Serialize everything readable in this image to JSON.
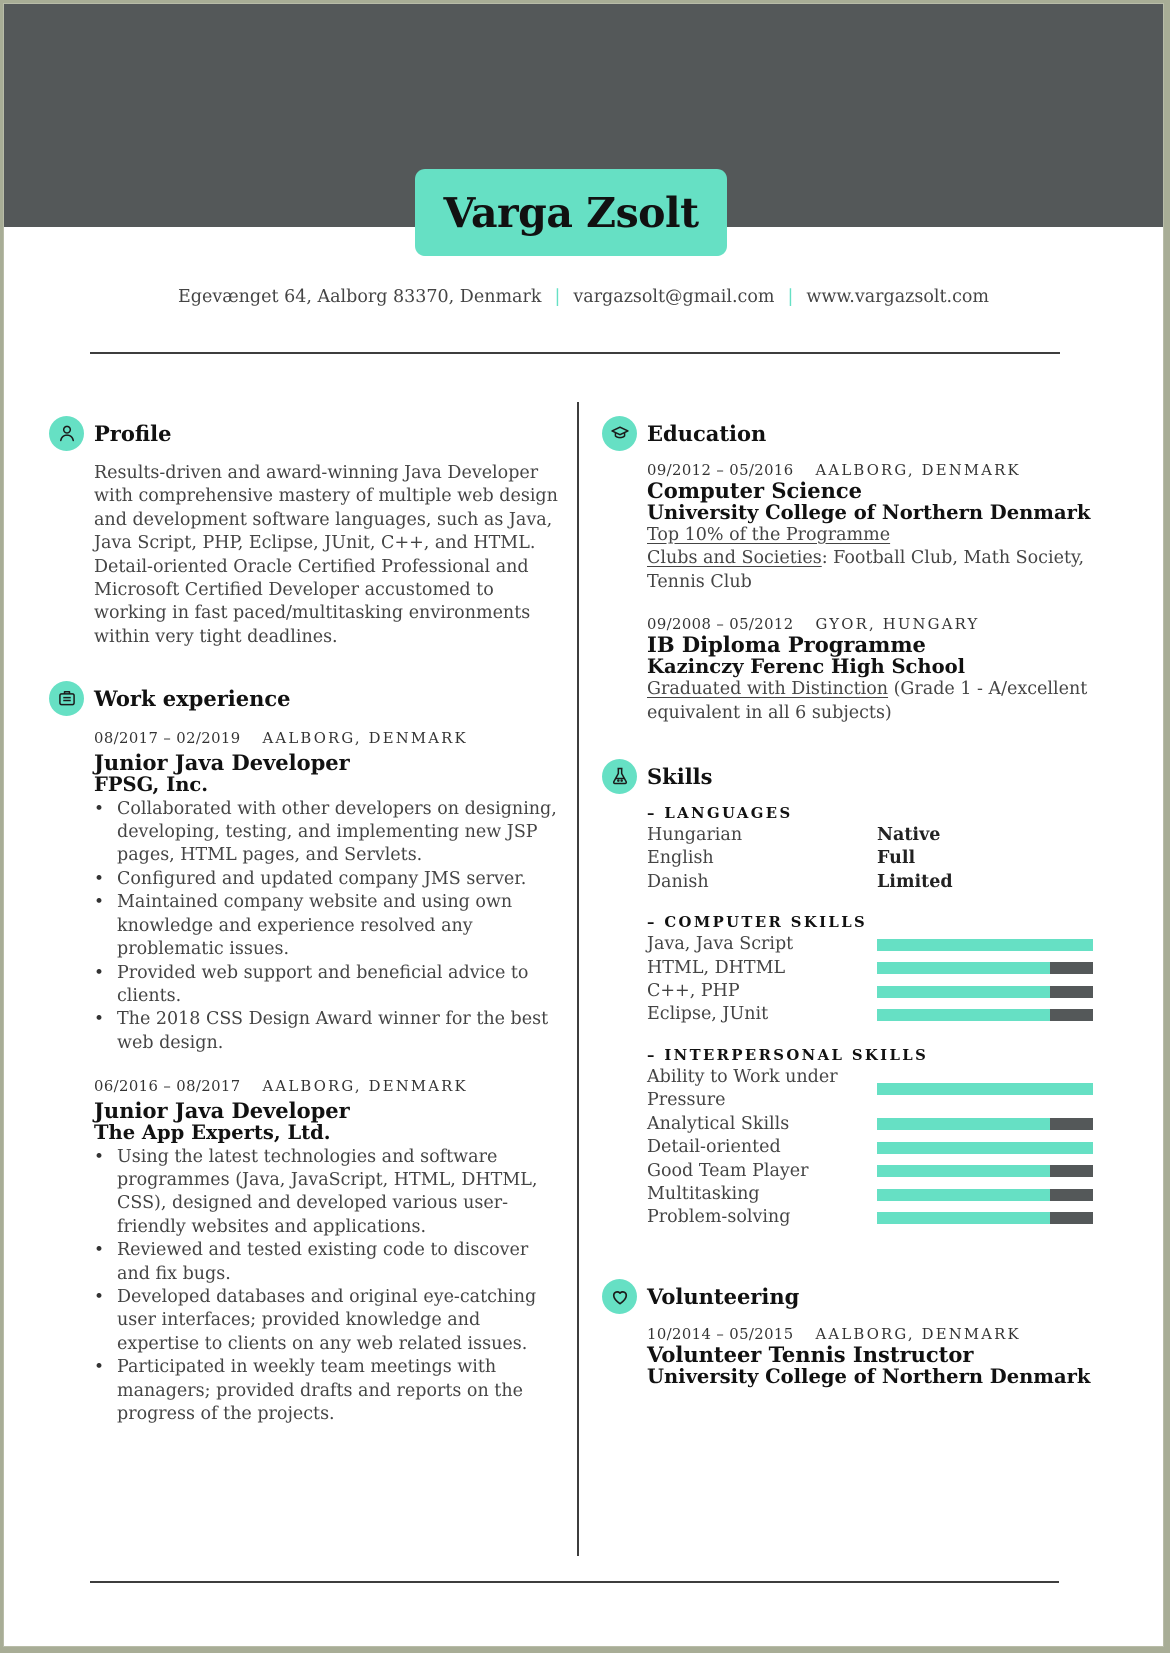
{
  "header": {
    "name": "Varga Zsolt",
    "address": "Egevænget 64, Aalborg 83370, Denmark",
    "email": "vargazsolt@gmail.com",
    "website": "www.vargazsolt.com",
    "separator": "|"
  },
  "colors": {
    "accent": "#66e0c4",
    "header_band": "#545859",
    "text_dark": "#111111",
    "text_body": "#444444"
  },
  "profile": {
    "title": "Profile",
    "icon": "person-icon",
    "paragraphs": [
      "Results-driven and award-winning Java Developer with comprehensive mastery of multiple web design and development software languages, such as Java, Java Script, PHP, Eclipse, JUnit, C++, and HTML.",
      "Detail-oriented Oracle Certified Professional and Microsoft Certified Developer accustomed to working in fast paced/multitasking environments within very tight deadlines."
    ]
  },
  "work": {
    "title": "Work experience",
    "icon": "briefcase-icon",
    "jobs": [
      {
        "dates": "08/2017 – 02/2019",
        "location": "AALBORG, DENMARK",
        "role": "Junior Java Developer",
        "company": "FPSG, Inc.",
        "bullets": [
          "Collaborated with other developers on designing, developing, testing, and implementing new JSP pages, HTML pages, and Servlets.",
          "Configured and updated company JMS server.",
          "Maintained company website and using own knowledge and experience resolved any problematic issues.",
          "Provided web support and beneficial advice to clients.",
          "The 2018 CSS Design Award winner for the best web design."
        ]
      },
      {
        "dates": "06/2016 – 08/2017",
        "location": "AALBORG, DENMARK",
        "role": "Junior Java Developer",
        "company": "The App Experts, Ltd.",
        "bullets": [
          "Using the latest technologies and software programmes (Java, JavaScript, HTML, DHTML, CSS), designed and developed various user-friendly websites and applications.",
          "Reviewed and tested existing code to discover and fix bugs.",
          "Developed databases and original eye-catching user interfaces; provided knowledge and expertise to clients on any web related issues.",
          "Participated in weekly team meetings with managers; provided drafts and reports on the progress of the projects."
        ]
      }
    ]
  },
  "education": {
    "title": "Education",
    "icon": "graduation-cap-icon",
    "items": [
      {
        "dates": "09/2012 – 05/2016",
        "location": "AALBORG, DENMARK",
        "degree": "Computer Science",
        "school": "University College of Northern Denmark",
        "highlight": "Top 10% of the Programme",
        "clubs_label": "Clubs and Societies",
        "clubs_value": ": Football Club, Math Society, Tennis Club"
      },
      {
        "dates": "09/2008 – 05/2012",
        "location": "GYOR, HUNGARY",
        "degree": "IB Diploma Programme",
        "school": "Kazinczy Ferenc High School",
        "highlight": "Graduated with Distinction",
        "highlight_rest": " (Grade 1 - A/excellent equivalent in all 6 subjects)"
      }
    ]
  },
  "skills": {
    "title": "Skills",
    "icon": "flask-icon",
    "languages_label": "– LANGUAGES",
    "languages": [
      {
        "name": "Hungarian",
        "level": "Native"
      },
      {
        "name": "English",
        "level": "Full"
      },
      {
        "name": "Danish",
        "level": "Limited"
      }
    ],
    "computer_label": "– COMPUTER SKILLS",
    "computer": [
      {
        "name": "Java, Java Script",
        "level": 1.0
      },
      {
        "name": "HTML, DHTML",
        "level": 0.8
      },
      {
        "name": "C++, PHP",
        "level": 0.8
      },
      {
        "name": "Eclipse, JUnit",
        "level": 0.8
      }
    ],
    "interpersonal_label": "– INTERPERSONAL SKILLS",
    "interpersonal": [
      {
        "name": "Ability to Work under Pressure",
        "level": 1.0
      },
      {
        "name": "Analytical Skills",
        "level": 0.8
      },
      {
        "name": "Detail-oriented",
        "level": 1.0
      },
      {
        "name": "Good Team Player",
        "level": 0.8
      },
      {
        "name": "Multitasking",
        "level": 0.8
      },
      {
        "name": "Problem-solving",
        "level": 0.8
      }
    ]
  },
  "volunteering": {
    "title": "Volunteering",
    "icon": "heart-icon",
    "items": [
      {
        "dates": "10/2014 – 05/2015",
        "location": "AALBORG, DENMARK",
        "role": "Volunteer Tennis Instructor",
        "org": "University College of Northern Denmark"
      }
    ]
  }
}
